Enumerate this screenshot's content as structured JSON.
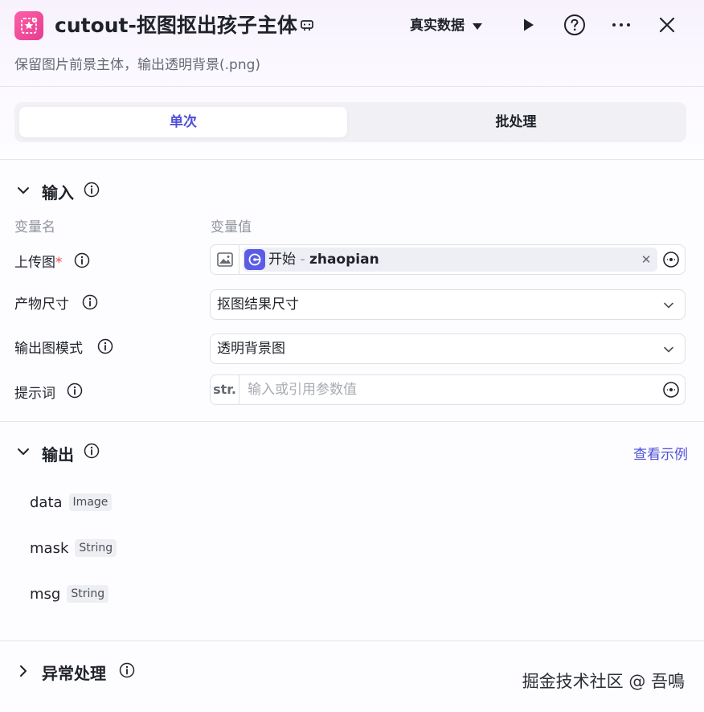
{
  "header": {
    "title": "cutout-抠图抠出孩子主体",
    "subtitle": "保留图片前景主体，输出透明背景(.png)",
    "data_mode": "真实数据"
  },
  "tabs": [
    {
      "label": "单次",
      "active": true
    },
    {
      "label": "批处理",
      "active": false
    }
  ],
  "input_section": {
    "title": "输入",
    "col_name": "变量名",
    "col_value": "变量值",
    "rows": [
      {
        "label": "上传图",
        "required_mark": "*",
        "ref_node": "开始",
        "ref_sep": " - ",
        "ref_var": "zhaopian"
      },
      {
        "label": "产物尺寸",
        "value": "抠图结果尺寸"
      },
      {
        "label": "输出图模式",
        "value": "透明背景图"
      },
      {
        "label": "提示词",
        "type_badge": "str.",
        "placeholder": "输入或引用参数值"
      }
    ]
  },
  "output_section": {
    "title": "输出",
    "link": "查看示例",
    "items": [
      {
        "name": "data",
        "type": "Image"
      },
      {
        "name": "mask",
        "type": "String"
      },
      {
        "name": "msg",
        "type": "String"
      }
    ]
  },
  "error_section": {
    "title": "异常处理"
  },
  "watermark": "掘金技术社区 @ 吾鳴",
  "colors": {
    "accent": "#4e50d6",
    "app_icon": "#e43d8f",
    "required": "#f54a45",
    "muted_text": "#8f959e"
  },
  "icons": [
    "app-icon",
    "debug-icon",
    "play-icon",
    "help-icon",
    "more-icon",
    "close-icon",
    "info-icon",
    "image-icon",
    "start-node-icon",
    "variable-icon",
    "chevron-down-icon",
    "chevron-right-icon"
  ]
}
